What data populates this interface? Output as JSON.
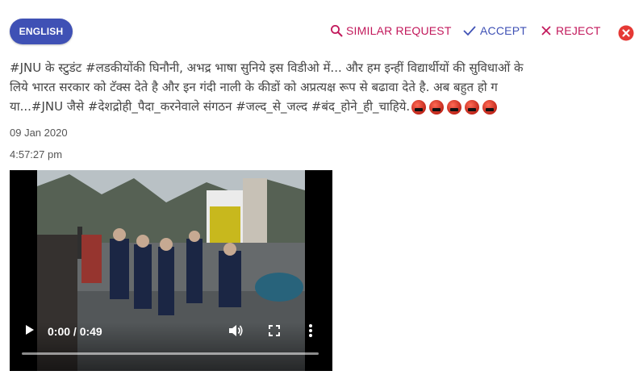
{
  "header": {
    "language_button": "ENGLISH",
    "actions": {
      "similar_request": "SIMILAR REQUEST",
      "accept": "ACCEPT",
      "reject": "REJECT"
    }
  },
  "post": {
    "text_line1": "#JNU के स्टुडंट #लडकीयोंकी घिनौनी, अभद्र भाषा सुनिये इस विडीओ में... और हम इन्हीं विद्यार्थीयों की सुविधाओं के",
    "text_line2": "लिये भारत सरकार को टॅक्स देते है और इन गंदी नाली के कीडों को अप्रत्यक्ष रूप से बढावा देते है. अब बहुत हो ग",
    "text_line3": "या...#JNU जैसे #देशद्रोही_पैदा_करनेवाले संगठन #जल्द_से_जल्द #बंद_होने_ही_चाहिये.",
    "emoji_count": 5,
    "emoji": "angry-face-with-symbols",
    "date": "09 Jan 2020",
    "time": "4:57:27 pm"
  },
  "video": {
    "time_display": "0:00 / 0:49",
    "progress_fraction": 0,
    "play_icon": "play-icon",
    "volume_icon": "volume-icon",
    "fullscreen_icon": "fullscreen-icon",
    "more_icon": "more-vert-icon"
  },
  "colors": {
    "accent_blue": "#3f51b5",
    "accent_pink": "#c2185b",
    "close_red": "#e53935"
  }
}
